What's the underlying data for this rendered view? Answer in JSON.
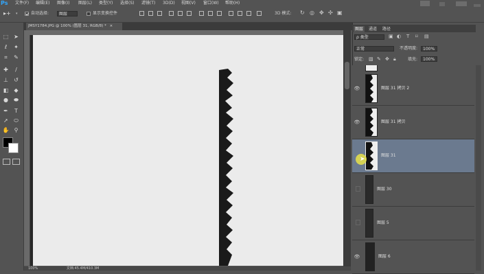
{
  "app": {
    "logo": "Ps"
  },
  "menu": [
    "文件(F)",
    "编辑(E)",
    "图像(I)",
    "图层(L)",
    "类型(Y)",
    "选择(S)",
    "滤镜(T)",
    "3D(D)",
    "视图(V)",
    "窗口(W)",
    "帮助(H)"
  ],
  "options": {
    "auto_select_label": "自动选择:",
    "auto_select_value": "图层",
    "show_transform_label": "显示变换控件",
    "mode_3d_label": "3D 模式:"
  },
  "document": {
    "tab_title": "JMSY1784.JPG @ 100% (图层 31, RGB/8) *",
    "close_glyph": "×",
    "zoom": "100%",
    "doc_info": "文档:45.4M/410.3M"
  },
  "panel": {
    "tabs": [
      "图层",
      "通道",
      "路径"
    ],
    "filter_kind": "ρ 类型",
    "blend_mode": "正常",
    "opacity_label": "不透明度:",
    "opacity_value": "100%",
    "lock_label": "锁定:",
    "fill_label": "填充:",
    "fill_value": "100%",
    "layers": [
      {
        "name": "",
        "visible": false,
        "selected": false
      },
      {
        "name": "图层 31 拷贝 2",
        "visible": true,
        "selected": false
      },
      {
        "name": "图层 31 拷贝",
        "visible": true,
        "selected": false
      },
      {
        "name": "图层 31",
        "visible": true,
        "selected": true
      },
      {
        "name": "图层 30",
        "visible": false,
        "selected": false
      },
      {
        "name": "图层 5",
        "visible": false,
        "selected": false
      },
      {
        "name": "图层 6",
        "visible": true,
        "selected": false
      }
    ]
  },
  "icons": {
    "eye": "eye-icon",
    "move_tool": "move-tool-icon",
    "lock": "lock-icon"
  },
  "colors": {
    "ui_bg": "#535353",
    "selected_layer": "#6b7a8f",
    "canvas": "#ebebeb",
    "cursor_highlight": "#e8e24a"
  }
}
